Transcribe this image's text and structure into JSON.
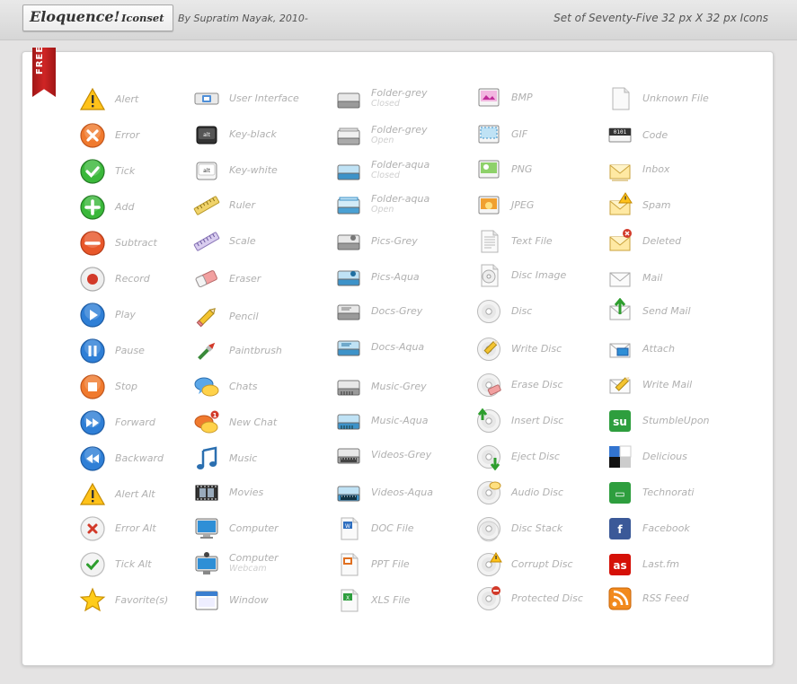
{
  "header": {
    "title": "Eloquence!",
    "title_suffix": "Iconset",
    "byline": "By Supratim Nayak, 2010-",
    "set_info": "Set of Seventy-Five 32 px X 32 px Icons"
  },
  "ribbon": {
    "label": "FREE",
    "color": "#c22020"
  },
  "colors": {
    "label_text": "#b0b0b0",
    "sub_text": "#cfcfcf",
    "panel_bg": "#ffffff",
    "page_bg": "#e4e3e3"
  },
  "columns": [
    {
      "items": [
        {
          "label": "Alert",
          "icon": "alert-icon"
        },
        {
          "label": "Error",
          "icon": "error-icon"
        },
        {
          "label": "Tick",
          "icon": "tick-icon"
        },
        {
          "label": "Add",
          "icon": "add-icon"
        },
        {
          "label": "Subtract",
          "icon": "subtract-icon"
        },
        {
          "label": "Record",
          "icon": "record-icon"
        },
        {
          "label": "Play",
          "icon": "play-icon"
        },
        {
          "label": "Pause",
          "icon": "pause-icon"
        },
        {
          "label": "Stop",
          "icon": "stop-icon"
        },
        {
          "label": "Forward",
          "icon": "forward-icon"
        },
        {
          "label": "Backward",
          "icon": "backward-icon"
        },
        {
          "label": "Alert Alt",
          "icon": "alert-alt-icon"
        },
        {
          "label": "Error Alt",
          "icon": "error-alt-icon"
        },
        {
          "label": "Tick Alt",
          "icon": "tick-alt-icon"
        },
        {
          "label": "Favorite(s)",
          "icon": "favorite-icon"
        }
      ]
    },
    {
      "items": [
        {
          "label": "User Interface",
          "icon": "user-interface-icon"
        },
        {
          "label": "Key-black",
          "icon": "key-black-icon"
        },
        {
          "label": "Key-white",
          "icon": "key-white-icon"
        },
        {
          "label": "Ruler",
          "icon": "ruler-icon"
        },
        {
          "label": "Scale",
          "icon": "scale-icon"
        },
        {
          "label": "Eraser",
          "icon": "eraser-icon"
        },
        {
          "label": "Pencil",
          "icon": "pencil-icon"
        },
        {
          "label": "Paintbrush",
          "icon": "paintbrush-icon"
        },
        {
          "label": "Chats",
          "icon": "chats-icon"
        },
        {
          "label": "New Chat",
          "icon": "new-chat-icon"
        },
        {
          "label": "Music",
          "icon": "music-icon"
        },
        {
          "label": "Movies",
          "icon": "movies-icon"
        },
        {
          "label": "Computer",
          "icon": "computer-icon"
        },
        {
          "label": "Computer",
          "sub": "Webcam",
          "icon": "computer-webcam-icon"
        },
        {
          "label": "Window",
          "icon": "window-icon"
        }
      ]
    },
    {
      "items": [
        {
          "label": "Folder-grey",
          "sub": "Closed",
          "icon": "folder-grey-closed-icon"
        },
        {
          "label": "Folder-grey",
          "sub": "Open",
          "icon": "folder-grey-open-icon"
        },
        {
          "label": "Folder-aqua",
          "sub": "Closed",
          "icon": "folder-aqua-closed-icon"
        },
        {
          "label": "Folder-aqua",
          "sub": "Open",
          "icon": "folder-aqua-open-icon"
        },
        {
          "label": "Pics-Grey",
          "icon": "pics-grey-icon"
        },
        {
          "label": "Pics-Aqua",
          "icon": "pics-aqua-icon"
        },
        {
          "label": "Docs-Grey",
          "icon": "docs-grey-icon"
        },
        {
          "label": "Docs-Aqua",
          "icon": "docs-aqua-icon"
        },
        {
          "label": "Music-Grey",
          "icon": "music-grey-icon"
        },
        {
          "label": "Music-Aqua",
          "icon": "music-aqua-icon"
        },
        {
          "label": "Videos-Grey",
          "icon": "videos-grey-icon"
        },
        {
          "label": "Videos-Aqua",
          "icon": "videos-aqua-icon"
        },
        {
          "label": "DOC File",
          "icon": "doc-file-icon"
        },
        {
          "label": "PPT File",
          "icon": "ppt-file-icon"
        },
        {
          "label": "XLS File",
          "icon": "xls-file-icon"
        }
      ]
    },
    {
      "items": [
        {
          "label": "BMP",
          "icon": "bmp-icon"
        },
        {
          "label": "GIF",
          "icon": "gif-icon"
        },
        {
          "label": "PNG",
          "icon": "png-icon"
        },
        {
          "label": "JPEG",
          "icon": "jpeg-icon"
        },
        {
          "label": "Text File",
          "icon": "text-file-icon"
        },
        {
          "label": "Disc Image",
          "icon": "disc-image-icon"
        },
        {
          "label": "Disc",
          "icon": "disc-icon"
        },
        {
          "label": "Write Disc",
          "icon": "write-disc-icon"
        },
        {
          "label": "Erase Disc",
          "icon": "erase-disc-icon"
        },
        {
          "label": "Insert Disc",
          "icon": "insert-disc-icon"
        },
        {
          "label": "Eject Disc",
          "icon": "eject-disc-icon"
        },
        {
          "label": "Audio Disc",
          "icon": "audio-disc-icon"
        },
        {
          "label": "Disc Stack",
          "icon": "disc-stack-icon"
        },
        {
          "label": "Corrupt Disc",
          "icon": "corrupt-disc-icon"
        },
        {
          "label": "Protected Disc",
          "icon": "protected-disc-icon"
        }
      ]
    },
    {
      "items": [
        {
          "label": "Unknown File",
          "icon": "unknown-file-icon"
        },
        {
          "label": "Code",
          "icon": "code-icon"
        },
        {
          "label": "Inbox",
          "icon": "inbox-icon"
        },
        {
          "label": "Spam",
          "icon": "spam-icon"
        },
        {
          "label": "Deleted",
          "icon": "deleted-icon"
        },
        {
          "label": "Mail",
          "icon": "mail-icon"
        },
        {
          "label": "Send Mail",
          "icon": "send-mail-icon"
        },
        {
          "label": "Attach",
          "icon": "attach-icon"
        },
        {
          "label": "Write Mail",
          "icon": "write-mail-icon"
        },
        {
          "label": "StumbleUpon",
          "icon": "stumbleupon-icon"
        },
        {
          "label": "Delicious",
          "icon": "delicious-icon"
        },
        {
          "label": "Technorati",
          "icon": "technorati-icon"
        },
        {
          "label": "Facebook",
          "icon": "facebook-icon"
        },
        {
          "label": "Last.fm",
          "icon": "lastfm-icon"
        },
        {
          "label": "RSS Feed",
          "icon": "rss-feed-icon"
        }
      ]
    }
  ]
}
